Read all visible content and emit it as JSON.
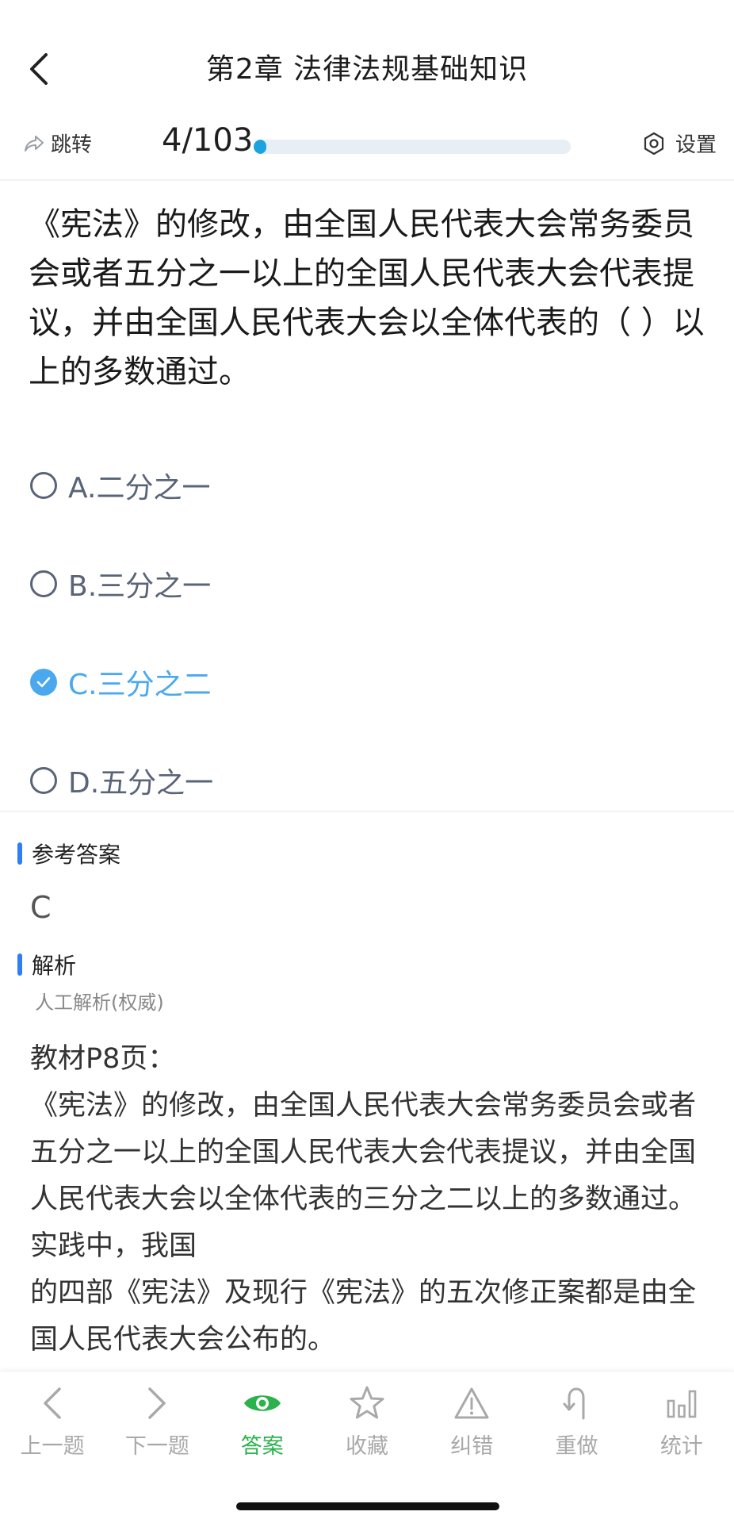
{
  "header": {
    "title": "第2章  法律法规基础知识"
  },
  "progress": {
    "jump_label": "跳转",
    "current": 4,
    "total": 103,
    "count_text": "4/103",
    "fraction": 0.0388,
    "settings_label": "设置"
  },
  "question": {
    "text": "《宪法》的修改，由全国人民代表大会常务委员会或者五分之一以上的全国人民代表大会代表提议，并由全国人民代表大会以全体代表的（ ）以上的多数通过。",
    "options": [
      {
        "label": "A.二分之一",
        "selected": false
      },
      {
        "label": "B.三分之一",
        "selected": false
      },
      {
        "label": "C.三分之二",
        "selected": true
      },
      {
        "label": "D.五分之一",
        "selected": false
      }
    ]
  },
  "answer": {
    "section_label": "参考答案",
    "value": "C"
  },
  "analysis": {
    "section_label": "解析",
    "source": "人工解析(权威)",
    "lines": [
      "教材P8页：",
      "《宪法》的修改，由全国人民代表大会常务委员会或者五分之一以上的全国人民代表大会代表提议，并由全国人民代表大会以全体代表的三分之二以上的多数通过。实践中，我国",
      "的四部《宪法》及现行《宪法》的五次修正案都是由全国人民代表大会公布的。"
    ]
  },
  "bottom_nav": {
    "prev": "上一题",
    "next": "下一题",
    "answer": "答案",
    "favorite": "收藏",
    "report": "纠错",
    "redo": "重做",
    "stats": "统计"
  },
  "colors": {
    "accent_blue": "#4aa8ef",
    "progress_blue": "#1aa3e0",
    "section_bar_blue": "#2f7ef5",
    "active_green": "#2bb24c",
    "inactive_gray": "#a9a9a9"
  }
}
